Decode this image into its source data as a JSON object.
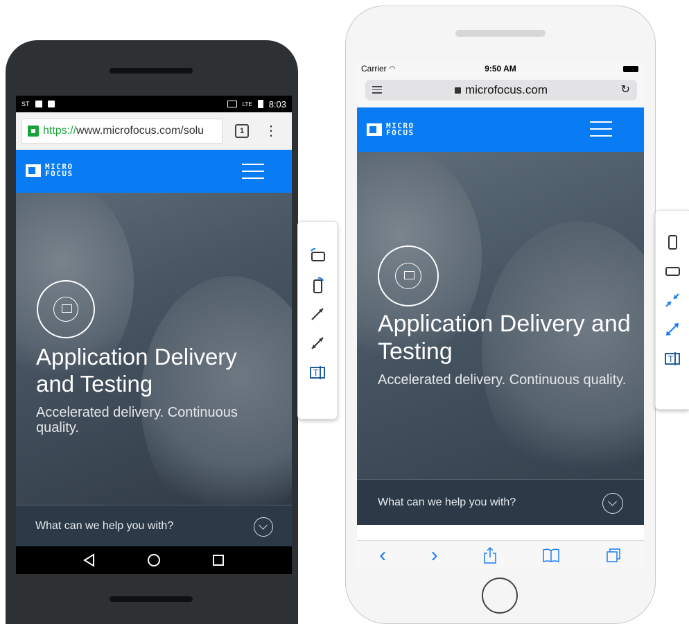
{
  "android": {
    "status": {
      "left_glyph": "ST",
      "time": "8:03",
      "network": "LTE"
    },
    "url": {
      "scheme": "https://",
      "rest": "www.microfocus.com/solu"
    },
    "tab_count": "1",
    "menu_glyph": "⋮",
    "logo": {
      "line1": "MICRO",
      "line2": "FOCUS"
    },
    "hero": {
      "title": "Application Delivery and Testing",
      "subtitle": "Accelerated delivery. Continuous quality."
    },
    "help_text": "What can we help you with?"
  },
  "iphone": {
    "status": {
      "carrier": "Carrier",
      "time": "9:50 AM"
    },
    "url": "microfocus.com",
    "reload_glyph": "↻",
    "logo": {
      "line1": "MICRO",
      "line2": "FOCUS"
    },
    "hero": {
      "title": "Application Delivery and Testing",
      "subtitle": "Accelerated delivery. Continuous quality."
    },
    "help_text": "What can we help you with?",
    "toolbar": {
      "back": "‹",
      "forward": "›"
    }
  },
  "toolbar_left": [
    "rotate-landscape-icon",
    "rotate-portrait-icon",
    "zoom-in-icon",
    "zoom-out-icon",
    "text-size-icon"
  ],
  "toolbar_right": [
    "portrait-icon",
    "landscape-icon",
    "shrink-icon",
    "expand-icon",
    "text-size-icon"
  ],
  "colors": {
    "brand_blue": "#0a7cf3",
    "help_bar": "#2c3a47",
    "ios_blue": "#1a7cf5",
    "lock_green": "#19a33a"
  }
}
